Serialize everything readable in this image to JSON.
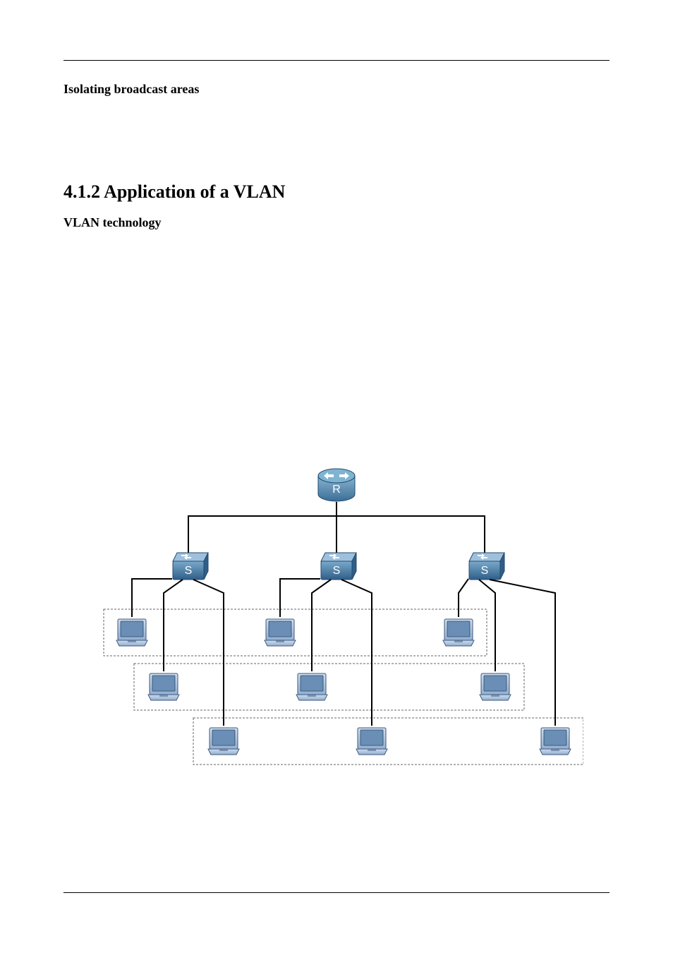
{
  "section_heading_1": "Isolating broadcast areas",
  "section_heading_2": "4.1.2 Application of a VLAN",
  "section_heading_3": "VLAN technology",
  "diagram": {
    "router_label": "R",
    "switch_label": "S"
  }
}
